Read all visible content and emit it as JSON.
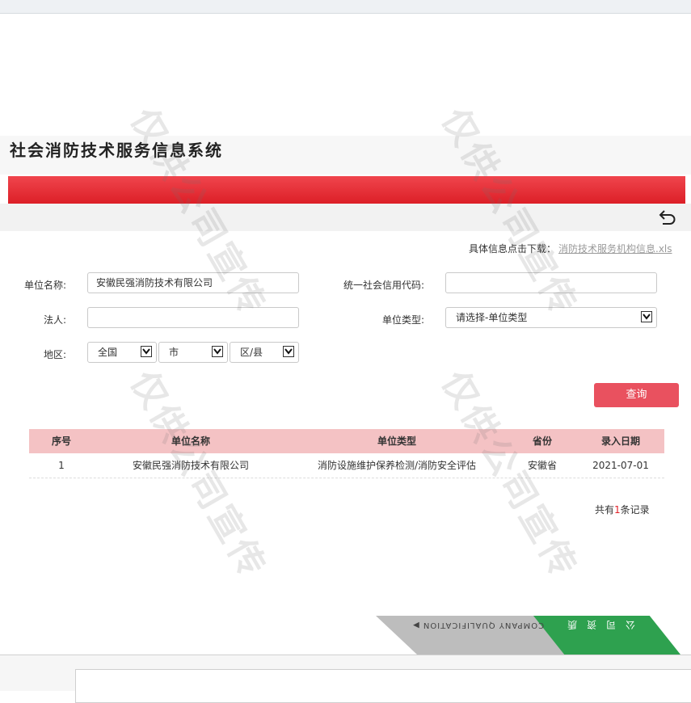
{
  "system_title": "社会消防技术服务信息系统",
  "download": {
    "label": "具体信息点击下载：",
    "link_text": "消防技术服务机构信息.xls"
  },
  "form": {
    "unit_name_label": "单位名称:",
    "unit_name_value": "安徽民强消防技术有限公司",
    "credit_code_label": "统一社会信用代码:",
    "credit_code_value": "",
    "legal_rep_label": "法人:",
    "legal_rep_value": "",
    "unit_type_label": "单位类型:",
    "unit_type_selected": "请选择-单位类型",
    "region_label": "地区:",
    "region_country": "全国",
    "region_city": "市",
    "region_district": "区/县"
  },
  "query_button": "查询",
  "table": {
    "headers": [
      "序号",
      "单位名称",
      "单位类型",
      "省份",
      "录入日期"
    ],
    "rows": [
      [
        "1",
        "安徽民强消防技术有限公司",
        "消防设施维护保养检测/消防安全评估",
        "安徽省",
        "2021-07-01"
      ]
    ]
  },
  "total": {
    "prefix": "共有",
    "count": "1",
    "suffix": "条记录"
  },
  "watermark_text": "仅供公司宣传",
  "banner": {
    "en": "COMPANY QUALIFICATION ▶",
    "cn": "公司资质"
  },
  "colors": {
    "red_bar": "#e21f26",
    "header_row": "#f4c2c4",
    "query_button": "#e9515f",
    "banner_green": "#2ea14f"
  }
}
